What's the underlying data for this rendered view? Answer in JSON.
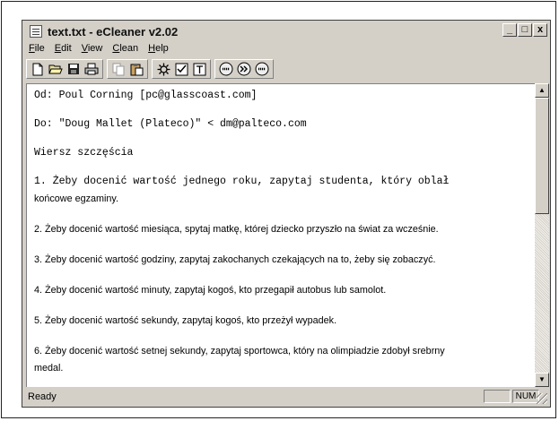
{
  "window": {
    "title": "text.txt - eCleaner v2.02",
    "controls": {
      "minimize": "_",
      "maximize": "□",
      "close": "x"
    }
  },
  "menu": [
    {
      "underline": "F",
      "rest": "ile"
    },
    {
      "underline": "E",
      "rest": "dit"
    },
    {
      "underline": "V",
      "rest": "iew"
    },
    {
      "underline": "C",
      "rest": "lean"
    },
    {
      "underline": "H",
      "rest": "elp"
    }
  ],
  "toolbar": {
    "icons": [
      "new-file-icon",
      "open-folder-icon",
      "save-icon",
      "print-icon",
      "copy-icon",
      "paste-icon",
      "gear-icon",
      "checkbox-icon",
      "text-icon",
      "html-icon",
      "forward-icon",
      "web-icon"
    ]
  },
  "document": {
    "line1": "Od: Poul Corning [pc@glasscoast.com]",
    "line2": "Do: \"Doug Mallet (Plateco)\" < dm@palteco.com",
    "line3": "Wiersz szczęścia",
    "line4a": "1. Żeby docenić wartość jednego roku, zapytaj studenta, który oblał",
    "line4b": "końcowe egzaminy.",
    "line5": "2. Żeby docenić wartość miesiąca, spytaj matkę, której dziecko przyszło na świat za wcześnie.",
    "line6": "3. Żeby docenić wartość godziny, zapytaj zakochanych czekających na to, żeby się zobaczyć.",
    "line7": "4. Żeby docenić wartość minuty, zapytaj kogoś, kto przegapił autobus lub samolot.",
    "line8": "5.  Żeby docenić wartość sekundy, zapytaj kogoś, kto przeżył wypadek.",
    "line9a": "6. Żeby docenić wartość setnej sekundy, zapytaj sportowca, który na olimpiadzie zdobył srebrny",
    "line9b": "medal."
  },
  "status": {
    "text": "Ready",
    "num": "NUM"
  }
}
